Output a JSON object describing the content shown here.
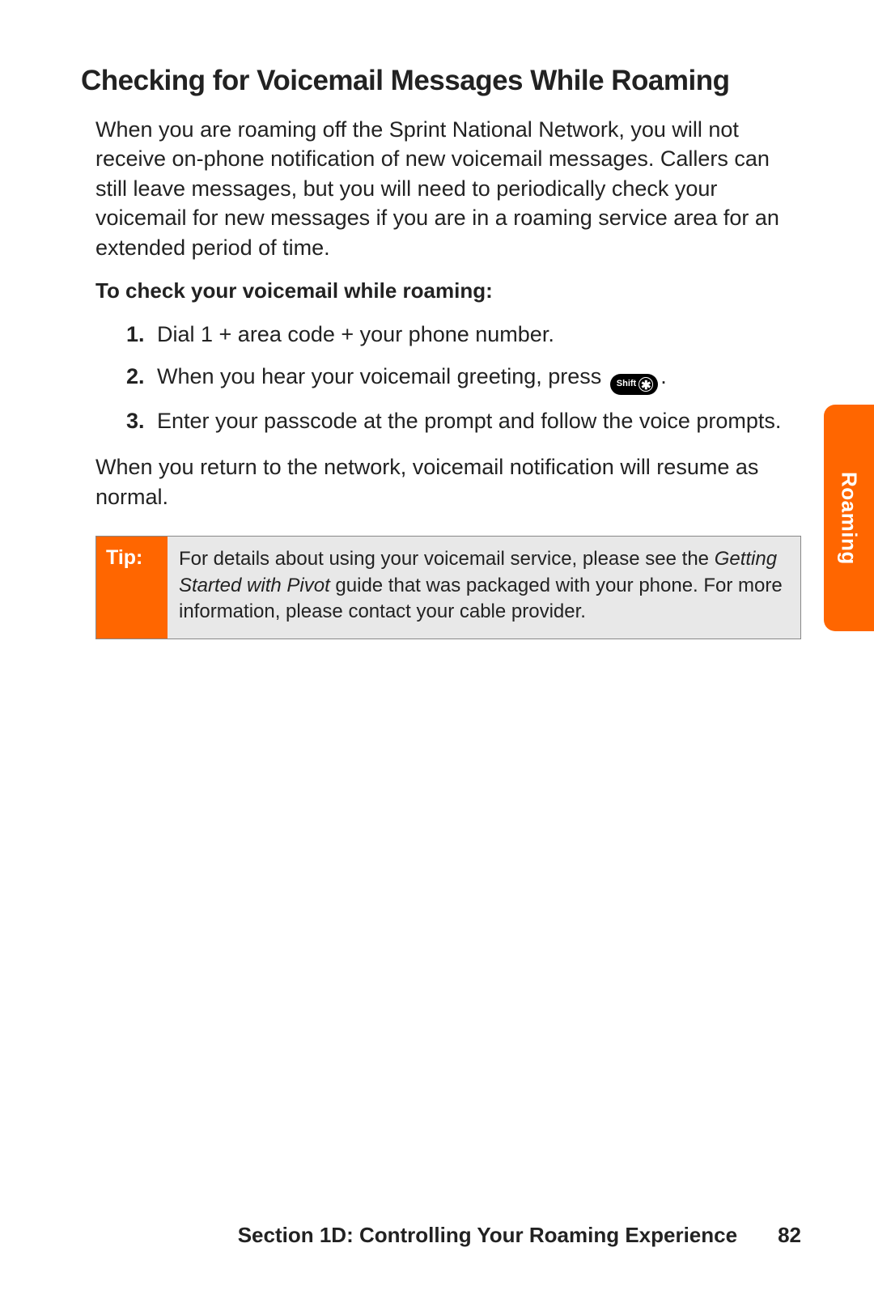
{
  "heading": "Checking for Voicemail Messages While Roaming",
  "intro": "When you are roaming off the Sprint National Network, you will not receive on-phone notification of new voicemail messages. Callers can still leave messages, but you will need to periodically check your voicemail for new messages if you are in a roaming service area for an extended period of time.",
  "subhead": "To check your voicemail while roaming:",
  "steps": [
    {
      "num": "1.",
      "text": "Dial 1 + area code + your phone number."
    },
    {
      "num": "2.",
      "text_before": "When you hear your voicemail greeting, press ",
      "key_shift": "Shift",
      "key_symbol": "✱",
      "text_after": "."
    },
    {
      "num": "3.",
      "text": "Enter your passcode at the prompt and follow the voice prompts."
    }
  ],
  "outro": "When you return to the network, voicemail notification will resume as normal.",
  "tip": {
    "label": "Tip:",
    "text_before": "For details about using your voicemail service, please see the ",
    "italic": "Getting Started with Pivot",
    "text_after": " guide that was packaged with your phone. For more information, please contact your cable provider."
  },
  "side_tab": "Roaming",
  "footer": {
    "section": "Section 1D: Controlling Your Roaming Experience",
    "page": "82"
  }
}
